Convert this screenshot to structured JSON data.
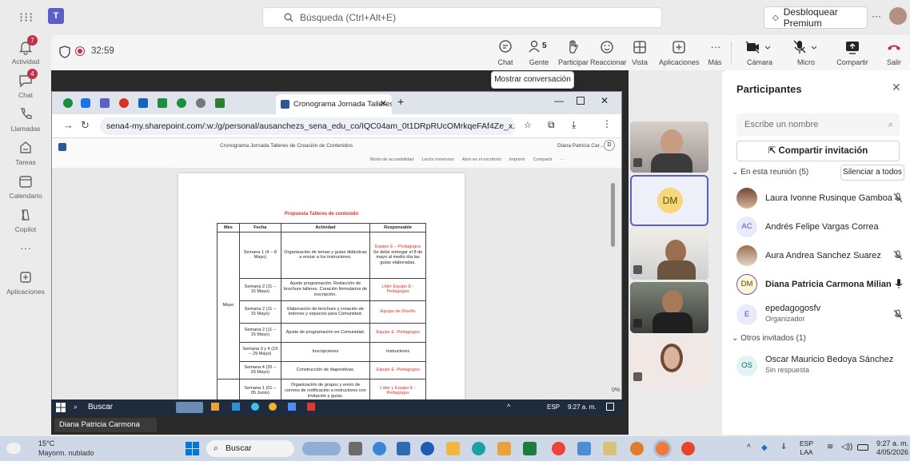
{
  "app": {
    "title": "Microsoft Teams"
  },
  "topbar": {
    "search_placeholder": "Búsqueda (Ctrl+Alt+E)",
    "premium_label": "Desbloquear Premium",
    "more_label": "···"
  },
  "rail": {
    "items": [
      {
        "label": "Actividad",
        "badge": "7",
        "icon": "bell-icon"
      },
      {
        "label": "Chat",
        "badge": "4",
        "icon": "chat-icon"
      },
      {
        "label": "Llamadas",
        "badge": "",
        "icon": "phone-icon"
      },
      {
        "label": "Tareas",
        "badge": "",
        "icon": "tasks-icon"
      },
      {
        "label": "Calendario",
        "badge": "",
        "icon": "calendar-icon"
      },
      {
        "label": "Copilot",
        "badge": "",
        "icon": "copilot-icon"
      },
      {
        "label": "···",
        "badge": "",
        "icon": "more-icon"
      },
      {
        "label": "Aplicaciones",
        "badge": "",
        "icon": "apps-icon"
      }
    ]
  },
  "meeting": {
    "timer": "32:59",
    "buttons": {
      "chat": "Chat",
      "people": "Gente",
      "people_count": "5",
      "raise": "Participar",
      "react": "Reaccionar",
      "view": "Vista",
      "apps": "Aplicaciones",
      "more": "Más",
      "camera": "Cámara",
      "mic": "Micro",
      "share": "Compartir",
      "leave": "Salir"
    },
    "tooltip": "Mostrar conversación"
  },
  "browser": {
    "tab_title": "Cronograma Jornada Talleres d",
    "url": "sena4-my.sharepoint.com/:w:/g/personal/ausanchezs_sena_edu_co/IQC04am_0t1DRpRUcOMrkqeFAf4Ze_x...",
    "doc_header": "Cronograma Jornada Talleres de Creación de Contenidos",
    "doc_user": "Diana Patricia Car...",
    "doc_user_initial": "D",
    "toolbar": [
      "Modo de accesibilidad",
      "Lector inmersivo",
      "Abrir en el escritorio",
      "Imprimir",
      "Compartir",
      "···"
    ],
    "zoom": "0%"
  },
  "document": {
    "title": "Propuesta Talleres de contenido",
    "headers": [
      "Mes",
      "Fecha",
      "Actividad",
      "Responsable"
    ],
    "month": "Mayo",
    "rows": [
      {
        "fecha": "Semana 1 (4 – 8 Mayo)",
        "actividad": "Organización de temas y guías didácticas a enviar a los instructores.",
        "resp_red": "Equipo E – Pedagogos",
        "resp_black": "Se debe entregar el 8 de mayo al medio día las guías elaboradas."
      },
      {
        "fecha": "Semana 2 (11 – 15 Mayo)",
        "actividad": "Ajuste programación. Redacción de brochure talleres. Creación formularios de inscripción.",
        "resp_red": "Líder Equipo E -Pedagogos",
        "resp_black": ""
      },
      {
        "fecha": "Semana 2 (11 – 15 Mayo)",
        "actividad": "Elaboración de brochure y creación de botones y espacios para Comunidad.",
        "resp_red": "Equipo de Diseño",
        "resp_black": ""
      },
      {
        "fecha": "Semana 2 (11 – 15 Mayo)",
        "actividad": "Ajuste de programación en Comunidad.",
        "resp_red": "Equipo E -Pedagogos",
        "resp_black": ""
      },
      {
        "fecha": "Semana 3 y 4 (19 – 29 Mayo)",
        "actividad": "Inscripciones",
        "resp_red": "",
        "resp_black": "Instructores"
      },
      {
        "fecha": "Semana 4 (25 – 29 Mayo)",
        "actividad": "Construcción de diapositivas.",
        "resp_red": "Equipo E -Pedagogos",
        "resp_black": ""
      },
      {
        "fecha": "Semana 1 (01 – 05 Junio)",
        "actividad": "Organización de grupos y envío de correos de notificación a instructores con invitación y guías.",
        "resp_red": "Líder y Equipo E -Pedagogos",
        "resp_black": ""
      }
    ]
  },
  "shared_taskbar": {
    "search": "Buscar",
    "lang": "ESP",
    "time": "9:27 a. m."
  },
  "presenter_name": "Diana Patricia Carmona Milian",
  "video_tiles": {
    "dm_initials": "DM"
  },
  "participants": {
    "title": "Participantes",
    "search_placeholder": "Escribe un nombre",
    "invite_label": "Compartir invitación",
    "in_meeting_label": "En esta reunión (5)",
    "mute_all": "Silenciar a todos",
    "list": [
      {
        "name": "Laura Ivonne Rusinque Gamboa",
        "initials": "",
        "sub": "",
        "mic": "muted"
      },
      {
        "name": "Andrés Felipe Vargas Correa",
        "initials": "AC",
        "sub": "",
        "mic": "none"
      },
      {
        "name": "Aura Andrea Sanchez Suarez",
        "initials": "",
        "sub": "",
        "mic": "muted"
      },
      {
        "name": "Diana Patricia Carmona Milian",
        "initials": "DM",
        "sub": "",
        "mic": "on"
      },
      {
        "name": "epedagogosfv",
        "initials": "E",
        "sub": "Organizador",
        "mic": "muted"
      }
    ],
    "others_label": "Otros invitados (1)",
    "others": [
      {
        "name": "Oscar Mauricio Bedoya Sánchez",
        "initials": "OS",
        "sub": "Sin respuesta"
      }
    ]
  },
  "taskbar": {
    "weather_temp": "15°C",
    "weather_desc": "Mayorm. nublado",
    "search": "Buscar",
    "lang_top": "ESP",
    "lang_bottom": "LAA",
    "time": "9:27 a. m.",
    "date": "4/05/2026"
  },
  "colors": {
    "accent": "#5b5fc7",
    "red": "#c4314b",
    "leave": "#c4314b"
  }
}
